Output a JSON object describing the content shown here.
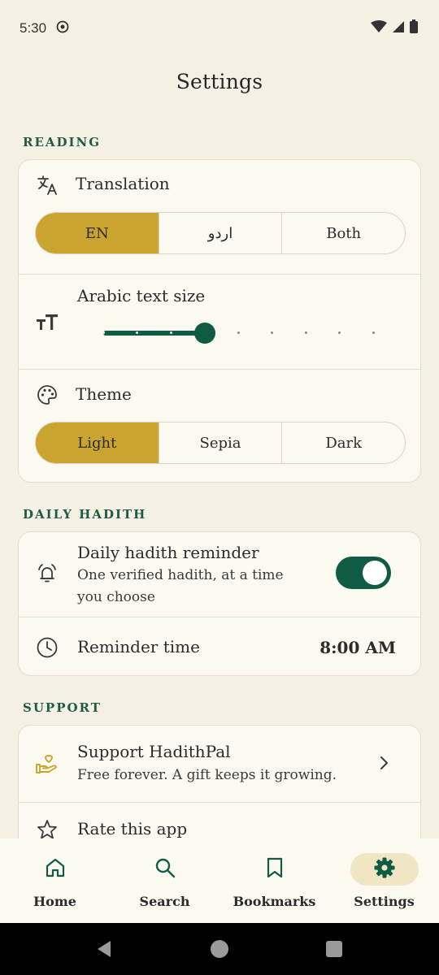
{
  "status_bar": {
    "time": "5:30"
  },
  "page": {
    "title": "Settings"
  },
  "sections": {
    "reading": "READING",
    "daily_hadith": "DAILY HADITH",
    "support": "SUPPORT"
  },
  "reading": {
    "translation": {
      "label": "Translation",
      "options": [
        "EN",
        "اردو",
        "Both"
      ],
      "selected": "EN"
    },
    "arabic_text_size": {
      "label": "Arabic text size",
      "steps": 9,
      "selected_step": 3
    },
    "theme": {
      "label": "Theme",
      "options": [
        "Light",
        "Sepia",
        "Dark"
      ],
      "selected": "Light"
    }
  },
  "daily_hadith": {
    "reminder": {
      "label": "Daily hadith reminder",
      "sublabel_line1": "One verified hadith, at a time",
      "sublabel_line2": "you choose",
      "enabled": true
    },
    "reminder_time": {
      "label": "Reminder time",
      "value": "8:00 AM"
    }
  },
  "support": {
    "support_item": {
      "label": "Support HadithPal",
      "sublabel": "Free forever. A gift keeps it growing."
    },
    "rate_item": {
      "label": "Rate this app"
    }
  },
  "bottom_nav": {
    "items": [
      {
        "label": "Home",
        "icon": "home-icon"
      },
      {
        "label": "Search",
        "icon": "search-icon"
      },
      {
        "label": "Bookmarks",
        "icon": "bookmark-icon"
      },
      {
        "label": "Settings",
        "icon": "gear-icon"
      }
    ],
    "active": "Settings"
  },
  "colors": {
    "background": "#f5f0e4",
    "accent_green": "#0f5b43",
    "accent_gold": "#caa42e",
    "nav_active_pill": "#f0e6c4"
  }
}
